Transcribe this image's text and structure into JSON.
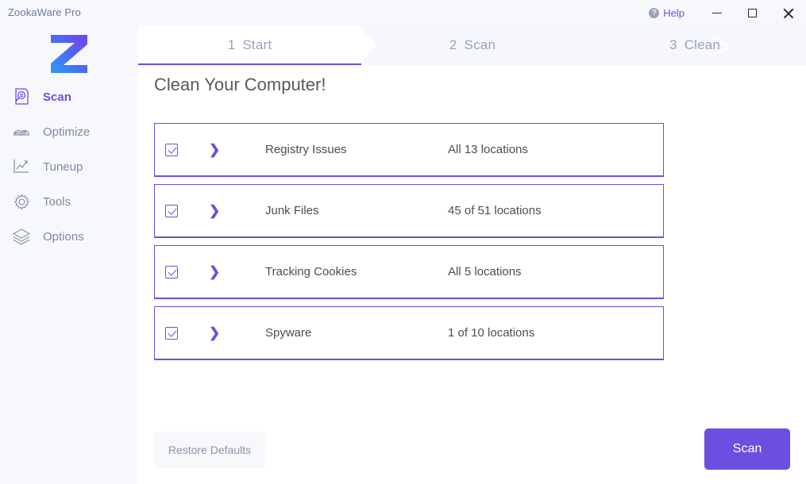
{
  "window": {
    "app_title": "ZookaWare Pro",
    "help_label": "Help",
    "help_icon": "question-circle-icon",
    "minimize_icon": "minimize-icon",
    "maximize_icon": "maximize-icon",
    "close_icon": "close-icon"
  },
  "brand": {
    "logo_letter": "Z",
    "gradient_start": "#2f9bf5",
    "gradient_end": "#7b3ff0",
    "accent": "#6c4fe0"
  },
  "sidebar": {
    "items": [
      {
        "label": "Scan",
        "icon": "document-search-icon",
        "active": true
      },
      {
        "label": "Optimize",
        "icon": "gauges-icon",
        "active": false
      },
      {
        "label": "Tuneup",
        "icon": "line-chart-icon",
        "active": false
      },
      {
        "label": "Tools",
        "icon": "gear-icon",
        "active": false
      },
      {
        "label": "Options",
        "icon": "layers-icon",
        "active": false
      }
    ]
  },
  "steps": [
    {
      "num": "1",
      "label": "Start",
      "active": true
    },
    {
      "num": "2",
      "label": "Scan",
      "active": false
    },
    {
      "num": "3",
      "label": "Clean",
      "active": false
    }
  ],
  "main": {
    "heading": "Clean Your Computer!",
    "rows": [
      {
        "name": "Registry Issues",
        "locations": "All 13 locations",
        "checked": true,
        "chevron": "chevron-right-icon"
      },
      {
        "name": "Junk Files",
        "locations": "45 of 51 locations",
        "checked": true,
        "chevron": "chevron-right-icon"
      },
      {
        "name": "Tracking Cookies",
        "locations": "All 5 locations",
        "checked": true,
        "chevron": "chevron-right-icon"
      },
      {
        "name": "Spyware",
        "locations": "1 of 10 locations",
        "checked": true,
        "chevron": "chevron-right-icon"
      }
    ]
  },
  "footer": {
    "restore_label": "Restore Defaults",
    "scan_label": "Scan"
  }
}
